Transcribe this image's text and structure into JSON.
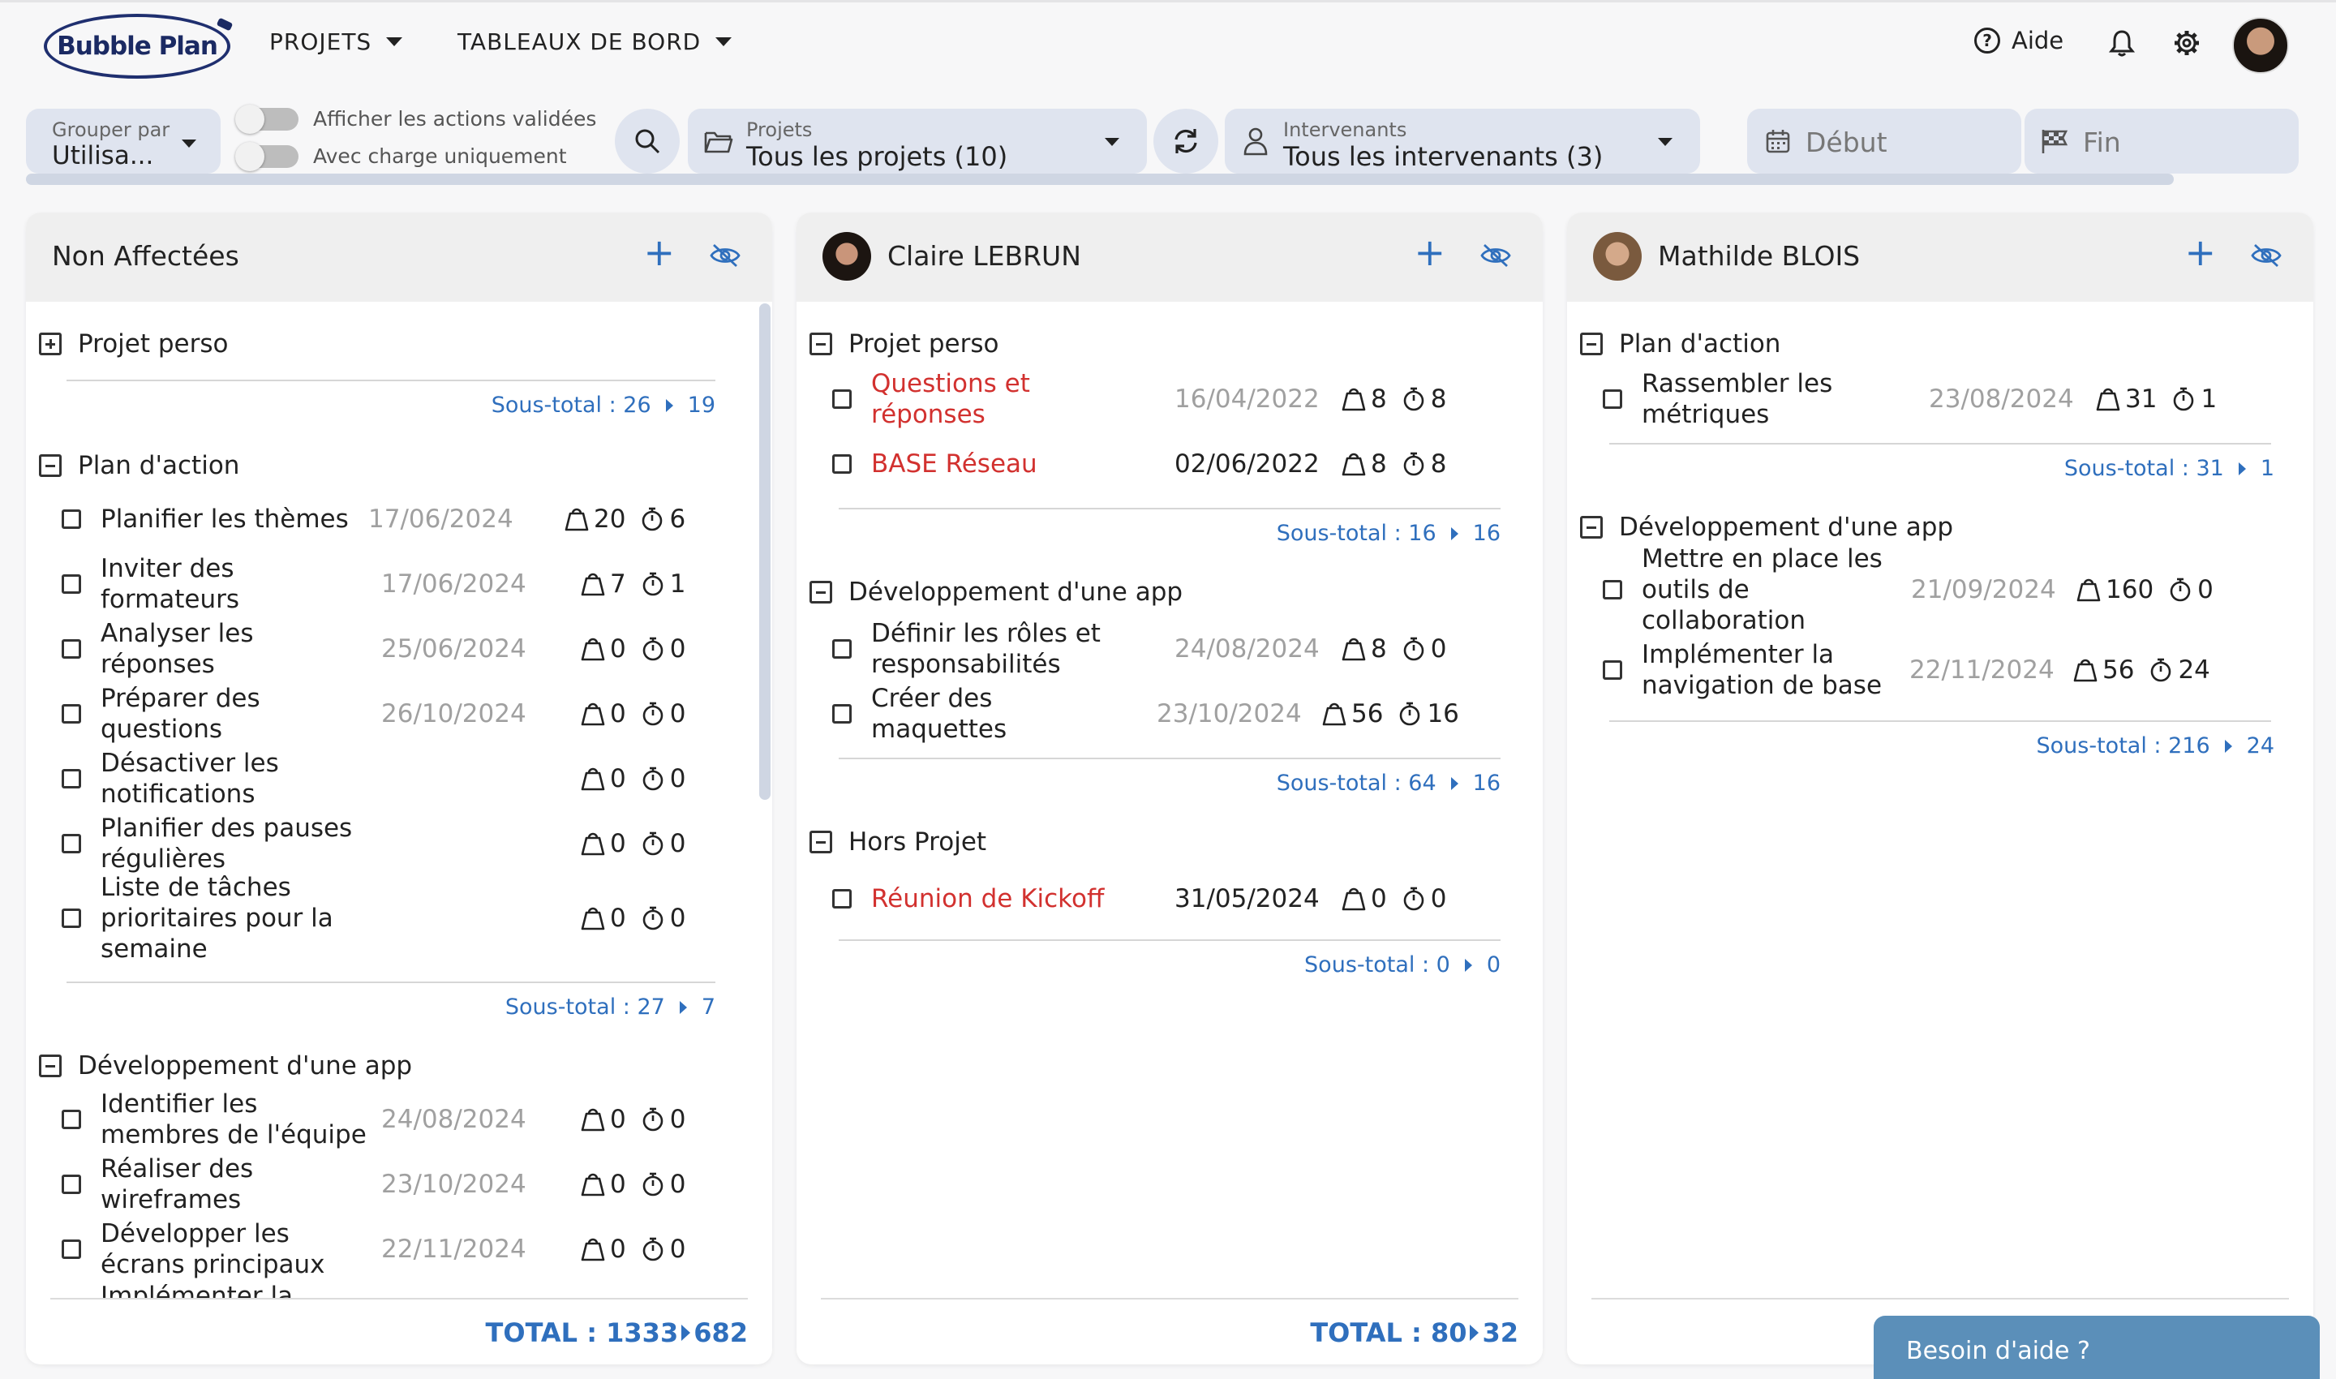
{
  "header": {
    "logo": "Bubble Plan",
    "menus": [
      {
        "label": "PROJETS"
      },
      {
        "label": "TABLEAUX DE BORD"
      }
    ],
    "help": "Aide"
  },
  "filters": {
    "group_by_label": "Grouper par",
    "group_by_value": "Utilisa...",
    "toggle_validated": "Afficher les actions validées",
    "toggle_charge": "Avec charge uniquement",
    "projects_label": "Projets",
    "projects_value": "Tous les projets (10)",
    "people_label": "Intervenants",
    "people_value": "Tous les intervenants (3)",
    "start": "Début",
    "end": "Fin"
  },
  "columns": [
    {
      "title": "Non Affectées",
      "total_label": "TOTAL : 1333",
      "total_value": "682",
      "groups": [
        {
          "name": "Projet perso",
          "collapsed": true,
          "subtotal_label": "Sous-total : 26",
          "subtotal_value": "19",
          "tasks": []
        },
        {
          "name": "Plan d'action",
          "subtotal_label": "Sous-total : 27",
          "subtotal_value": "7",
          "tasks": [
            {
              "name": "Planifier les thèmes",
              "date": "17/06/2024",
              "load": "20",
              "time": "6"
            },
            {
              "name": "Inviter des formateurs",
              "date": "17/06/2024",
              "load": "7",
              "time": "1"
            },
            {
              "name": "Analyser les réponses",
              "date": "25/06/2024",
              "load": "0",
              "time": "0"
            },
            {
              "name": "Préparer des questions",
              "date": "26/10/2024",
              "load": "0",
              "time": "0"
            },
            {
              "name": "Désactiver les notifications",
              "date": "",
              "load": "0",
              "time": "0"
            },
            {
              "name": "Planifier des pauses régulières",
              "date": "",
              "load": "0",
              "time": "0"
            },
            {
              "name": "Liste de tâches prioritaires pour la semaine",
              "date": "",
              "load": "0",
              "time": "0"
            }
          ]
        },
        {
          "name": "Développement d'une app",
          "tasks": [
            {
              "name": "Identifier les membres de l'équipe",
              "date": "24/08/2024",
              "load": "0",
              "time": "0"
            },
            {
              "name": "Réaliser des wireframes",
              "date": "23/10/2024",
              "load": "0",
              "time": "0"
            },
            {
              "name": "Développer les écrans principaux",
              "date": "22/11/2024",
              "load": "0",
              "time": "0"
            },
            {
              "name": "Implémenter la",
              "date": "",
              "load": "",
              "time": ""
            }
          ]
        }
      ]
    },
    {
      "title": "Claire LEBRUN",
      "total_label": "TOTAL : 80",
      "total_value": "32",
      "groups": [
        {
          "name": "Projet perso",
          "subtotal_label": "Sous-total : 16",
          "subtotal_value": "16",
          "tasks": [
            {
              "name": "Questions et réponses",
              "date": "16/04/2022",
              "load": "8",
              "time": "8",
              "overdue": true
            },
            {
              "name": "BASE Réseau",
              "date": "02/06/2022",
              "load": "8",
              "time": "8",
              "overdue": true
            }
          ]
        },
        {
          "name": "Développement d'une app",
          "subtotal_label": "Sous-total : 64",
          "subtotal_value": "16",
          "tasks": [
            {
              "name": "Définir les rôles et responsabilités",
              "date": "24/08/2024",
              "load": "8",
              "time": "0"
            },
            {
              "name": "Créer des maquettes",
              "date": "23/10/2024",
              "load": "56",
              "time": "16"
            }
          ]
        },
        {
          "name": "Hors Projet",
          "subtotal_label": "Sous-total : 0",
          "subtotal_value": "0",
          "tasks": [
            {
              "name": "Réunion de Kickoff",
              "date": "31/05/2024",
              "load": "0",
              "time": "0",
              "overdue": true
            }
          ]
        }
      ]
    },
    {
      "title": "Mathilde BLOIS",
      "groups": [
        {
          "name": "Plan d'action",
          "subtotal_label": "Sous-total : 31",
          "subtotal_value": "1",
          "tasks": [
            {
              "name": "Rassembler les métriques",
              "date": "23/08/2024",
              "load": "31",
              "time": "1"
            }
          ]
        },
        {
          "name": "Développement d'une app",
          "subtotal_label": "Sous-total : 216",
          "subtotal_value": "24",
          "tasks": [
            {
              "name": "Mettre en place les outils de collaboration",
              "date": "21/09/2024",
              "load": "160",
              "time": "0"
            },
            {
              "name": "Implémenter la navigation de base",
              "date": "22/11/2024",
              "load": "56",
              "time": "24"
            }
          ]
        }
      ]
    }
  ],
  "chat": "Besoin d'aide ?",
  "colors": {
    "accent": "#2f6fbd",
    "overdue": "#d2312f",
    "chat": "#5b8fb9",
    "pill": "#dfe4ef"
  }
}
